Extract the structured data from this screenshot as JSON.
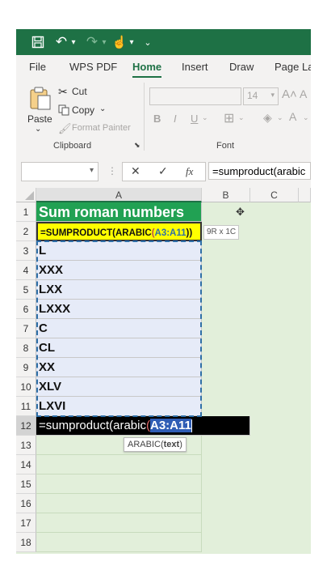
{
  "qat": {
    "save": "🖫",
    "undo": "↶",
    "redo": "↷",
    "touch": "☝",
    "more": "⌄"
  },
  "tabs": [
    "File",
    "WPS PDF",
    "Home",
    "Insert",
    "Draw",
    "Page La"
  ],
  "ribbon": {
    "paste": "Paste",
    "cut": "Cut",
    "copy": "Copy",
    "format_painter": "Format Painter",
    "clipboard_group": "Clipboard",
    "font_size": "14",
    "font_group": "Font",
    "bold": "B",
    "italic": "I",
    "underline": "U"
  },
  "formula_bar": {
    "name_box": "",
    "cancel": "✕",
    "enter": "✓",
    "fx": "fx",
    "content": "=sumproduct(arabic"
  },
  "columns": [
    "A",
    "B",
    "C"
  ],
  "rows": [
    {
      "num": "1",
      "a": "Sum roman numbers"
    },
    {
      "num": "2",
      "a": "=SUMPRODUCT(ARABIC(A3:A11))"
    },
    {
      "num": "3",
      "a": "L"
    },
    {
      "num": "4",
      "a": "XXX"
    },
    {
      "num": "5",
      "a": "LXX"
    },
    {
      "num": "6",
      "a": "LXXX"
    },
    {
      "num": "7",
      "a": "C"
    },
    {
      "num": "8",
      "a": "CL"
    },
    {
      "num": "9",
      "a": "XX"
    },
    {
      "num": "10",
      "a": "XLV"
    },
    {
      "num": "11",
      "a": "LXVI"
    },
    {
      "num": "12",
      "a": ""
    },
    {
      "num": "13",
      "a": ""
    },
    {
      "num": "14",
      "a": ""
    },
    {
      "num": "15",
      "a": ""
    },
    {
      "num": "16",
      "a": ""
    },
    {
      "num": "17",
      "a": ""
    },
    {
      "num": "18",
      "a": ""
    }
  ],
  "cell_a2": {
    "pre": "=SUMPRODUCT(ARABIC",
    "open": "(",
    "ref": "A3:A11",
    "close": "))"
  },
  "edit": {
    "pre": "=sumproduct(arabic",
    "open": "(",
    "ref": "A3:A11"
  },
  "selection_size": "9R x 1C",
  "tooltip": {
    "func": "ARABIC(",
    "arg": "text",
    "close": ")"
  },
  "colors": {
    "excel_green": "#1e7145",
    "title_cell": "#21a153",
    "formula_cell": "#ffff00",
    "sheet_bg": "#e2efda",
    "selection": "#e6ebf8"
  }
}
